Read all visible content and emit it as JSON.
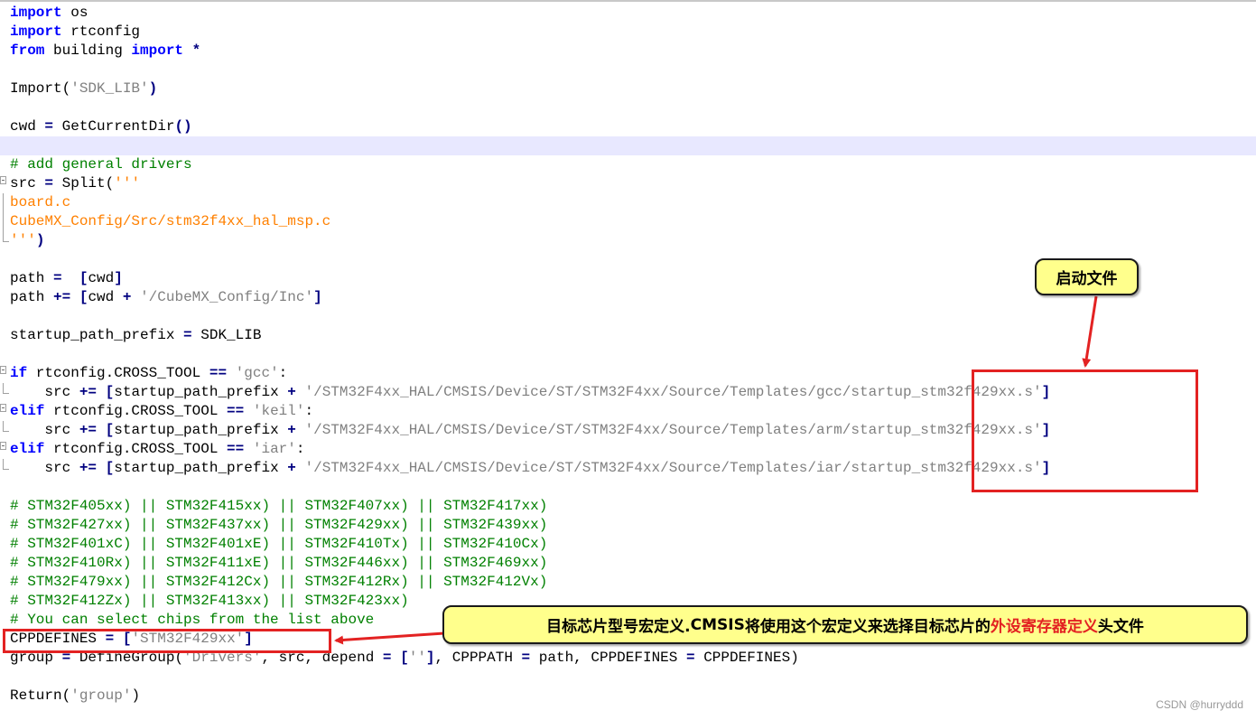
{
  "code": {
    "l1": [
      "import",
      " os"
    ],
    "l2": [
      "import",
      " rtconfig"
    ],
    "l3": [
      "from",
      " building ",
      "import",
      " *"
    ],
    "l5": [
      "Import(",
      "'SDK_LIB'",
      ")"
    ],
    "l7": [
      "cwd ",
      "=",
      " GetCurrentDir",
      "()"
    ],
    "l9": "# add general drivers",
    "l10": [
      "src ",
      "=",
      " Split(",
      "'''"
    ],
    "l11": "board.c",
    "l12": "CubeMX_Config/Src/stm32f4xx_hal_msp.c",
    "l13": [
      "'''",
      ")"
    ],
    "l15": [
      "path ",
      "=",
      "  ",
      "[",
      "cwd",
      "]"
    ],
    "l16": [
      "path ",
      "+=",
      " ",
      "[",
      "cwd ",
      "+",
      " ",
      "'/CubeMX_Config/Inc'",
      "]"
    ],
    "l18": [
      "startup_path_prefix ",
      "=",
      " SDK_LIB"
    ],
    "l20": [
      "if",
      " rtconfig.CROSS_TOOL ",
      "==",
      " ",
      "'gcc'",
      ":"
    ],
    "l21": [
      "    src ",
      "+=",
      " ",
      "[",
      "startup_path_prefix ",
      "+",
      " ",
      "'/STM32F4xx_HAL/CMSIS/Device/ST/STM32F4xx/Source/Templates/gcc/startup_stm32f429xx.s'",
      "]"
    ],
    "l22": [
      "elif",
      " rtconfig.CROSS_TOOL ",
      "==",
      " ",
      "'keil'",
      ":"
    ],
    "l23": [
      "    src ",
      "+=",
      " ",
      "[",
      "startup_path_prefix ",
      "+",
      " ",
      "'/STM32F4xx_HAL/CMSIS/Device/ST/STM32F4xx/Source/Templates/arm/startup_stm32f429xx.s'",
      "]"
    ],
    "l24": [
      "elif",
      " rtconfig.CROSS_TOOL ",
      "==",
      " ",
      "'iar'",
      ":"
    ],
    "l25": [
      "    src ",
      "+=",
      " ",
      "[",
      "startup_path_prefix ",
      "+",
      " ",
      "'/STM32F4xx_HAL/CMSIS/Device/ST/STM32F4xx/Source/Templates/iar/startup_stm32f429xx.s'",
      "]"
    ],
    "l27": "# STM32F405xx) || STM32F415xx) || STM32F407xx) || STM32F417xx)",
    "l28": "# STM32F427xx) || STM32F437xx) || STM32F429xx) || STM32F439xx)",
    "l29": "# STM32F401xC) || STM32F401xE) || STM32F410Tx) || STM32F410Cx)",
    "l30": "# STM32F410Rx) || STM32F411xE) || STM32F446xx) || STM32F469xx)",
    "l31": "# STM32F479xx) || STM32F412Cx) || STM32F412Rx) || STM32F412Vx)",
    "l32": "# STM32F412Zx) || STM32F413xx) || STM32F423xx)",
    "l33": "# You can select chips from the list above",
    "l34": [
      "CPPDEFINES ",
      "=",
      " ",
      "[",
      "'STM32F429xx'",
      "]"
    ],
    "l35": [
      "group ",
      "=",
      " DefineGroup(",
      "'Drivers'",
      ", src, depend ",
      "=",
      " ",
      "[",
      "''",
      "]",
      ", CPPPATH ",
      "=",
      " path, CPPDEFINES ",
      "=",
      " CPPDEFINES)"
    ],
    "l37": [
      "Return(",
      "'group'",
      ")"
    ]
  },
  "annotations": {
    "startup_callout": "启动文件",
    "cppdefines_callout": [
      "目标芯片型号宏定义. ",
      "CMSIS",
      "将使用这个宏定义来选择目标芯片的",
      "外设寄存器定义",
      "头文件"
    ]
  },
  "colors": {
    "keyword": "#0000ff",
    "operator": "#000080",
    "string": "#808080",
    "string_block": "#ff8000",
    "comment": "#008000",
    "annotation_red": "#e32222",
    "callout_bg": "#ffff8c",
    "current_line": "#e8e8ff"
  },
  "watermark": "CSDN @hurryddd"
}
